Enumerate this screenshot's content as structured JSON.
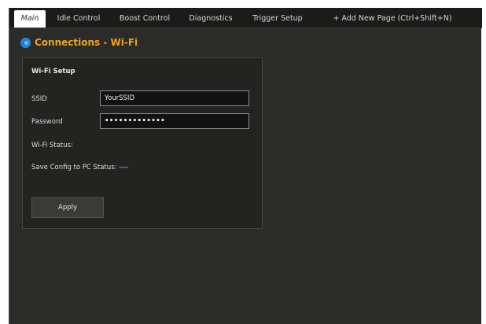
{
  "tabs": [
    {
      "label": "Main",
      "active": true
    },
    {
      "label": "Idle Control",
      "active": false
    },
    {
      "label": "Boost Control",
      "active": false
    },
    {
      "label": "Diagnostics",
      "active": false
    },
    {
      "label": "Trigger Setup",
      "active": false
    },
    {
      "label": "+ Add New Page (Ctrl+Shift+N)",
      "active": false
    }
  ],
  "page": {
    "title": "Connections - Wi-Fi",
    "toggle_state": "on"
  },
  "wifi_setup": {
    "title": "Wi-Fi Setup",
    "ssid_label": "SSID",
    "ssid_value": "YourSSID",
    "password_label": "Password",
    "password_value": "•••••••••••••",
    "wifi_status_label": "Wi-Fi Status:",
    "save_status_label": "Save Config to PC Status: ----",
    "apply_label": "Apply"
  },
  "colors": {
    "title_accent": "#f0a419",
    "toggle_blue": "#1f7fe0",
    "background": "#2b2b29",
    "tabbar": "#1b1b1a"
  }
}
